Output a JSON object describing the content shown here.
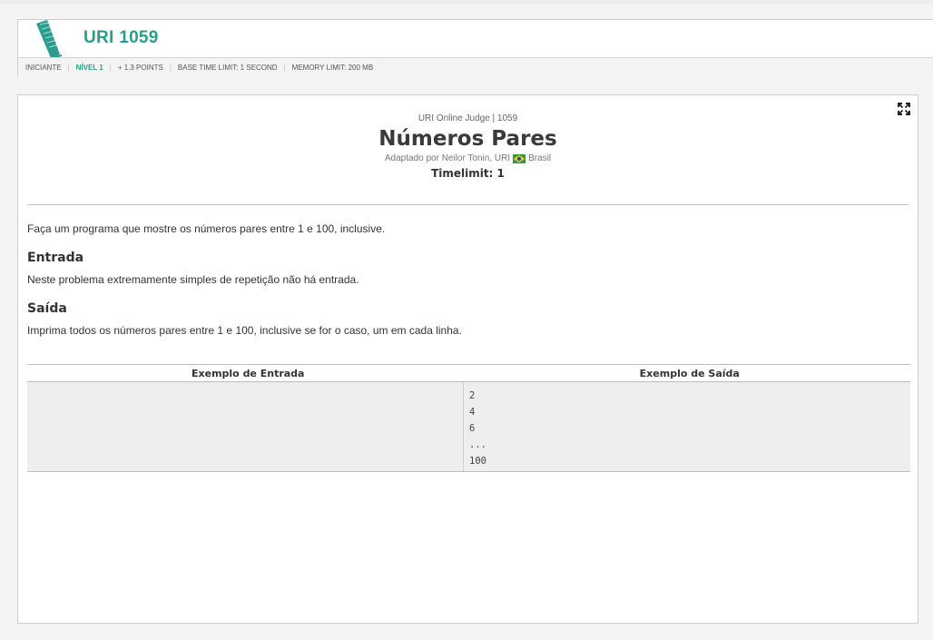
{
  "header": {
    "problem_code": "URI 1059",
    "info": {
      "category": "INICIANTE",
      "level": "NÍVEL 1",
      "points": "+ 1.3 POINTS",
      "base_time": "BASE TIME LIMIT: 1 SECOND",
      "memory": "MEMORY LIMIT: 200 MB"
    }
  },
  "problem": {
    "judge": "URI Online Judge | 1059",
    "title": "Números Pares",
    "author_prefix": "Adaptado por Neilor Tonin, URI",
    "country": "Brasil",
    "timelimit": "Timelimit: 1",
    "description": "Faça um programa que mostre os números pares entre 1 e 100, inclusive.",
    "input_title": "Entrada",
    "input_text": "Neste problema extremamente simples de repetição não há entrada.",
    "output_title": "Saída",
    "output_text": "Imprima todos os números pares entre 1 e 100, inclusive se for o caso, um em cada linha."
  },
  "samples": {
    "input_header": "Exemplo de Entrada",
    "output_header": "Exemplo de Saída",
    "output_lines": [
      "2",
      "4",
      "6",
      "...",
      "100"
    ]
  },
  "colors": {
    "accent": "#2a9d8f",
    "flag_green": "#3a9a3a",
    "flag_yellow": "#f2d22c",
    "flag_blue": "#234d9a"
  }
}
